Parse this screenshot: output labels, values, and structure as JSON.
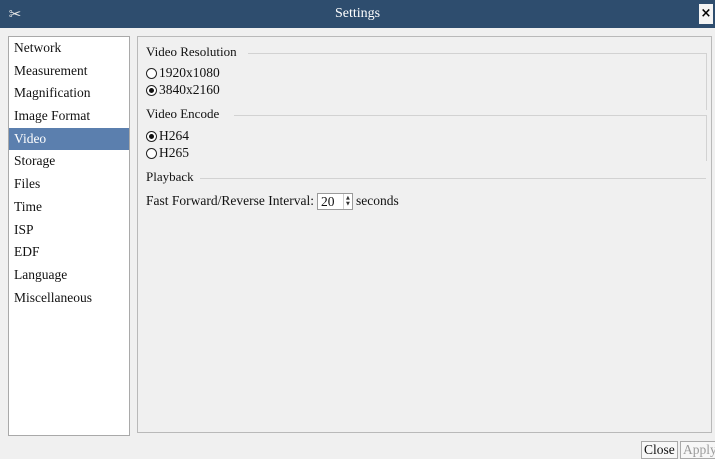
{
  "window": {
    "title": "Settings",
    "app_icon": "tools-icon",
    "close_glyph": "×"
  },
  "sidebar": {
    "items": [
      {
        "label": "Network"
      },
      {
        "label": "Measurement"
      },
      {
        "label": "Magnification"
      },
      {
        "label": "Image Format"
      },
      {
        "label": "Video",
        "selected": true
      },
      {
        "label": "Storage"
      },
      {
        "label": "Files"
      },
      {
        "label": "Time"
      },
      {
        "label": "ISP"
      },
      {
        "label": "EDF"
      },
      {
        "label": "Language"
      },
      {
        "label": "Miscellaneous"
      }
    ]
  },
  "video_resolution": {
    "title": "Video Resolution",
    "options": [
      {
        "label": "1920x1080",
        "checked": false
      },
      {
        "label": "3840x2160",
        "checked": true
      }
    ]
  },
  "video_encode": {
    "title": "Video Encode",
    "options": [
      {
        "label": "H264",
        "checked": true
      },
      {
        "label": "H265",
        "checked": false
      }
    ]
  },
  "playback": {
    "title": "Playback",
    "interval_label": "Fast Forward/Reverse Interval:",
    "interval_value": "20",
    "interval_unit": "seconds"
  },
  "buttons": {
    "close_label": "Close",
    "apply_label": "Apply"
  },
  "colors": {
    "titlebar": "#2e4d6e",
    "selection": "#5b7fae"
  }
}
